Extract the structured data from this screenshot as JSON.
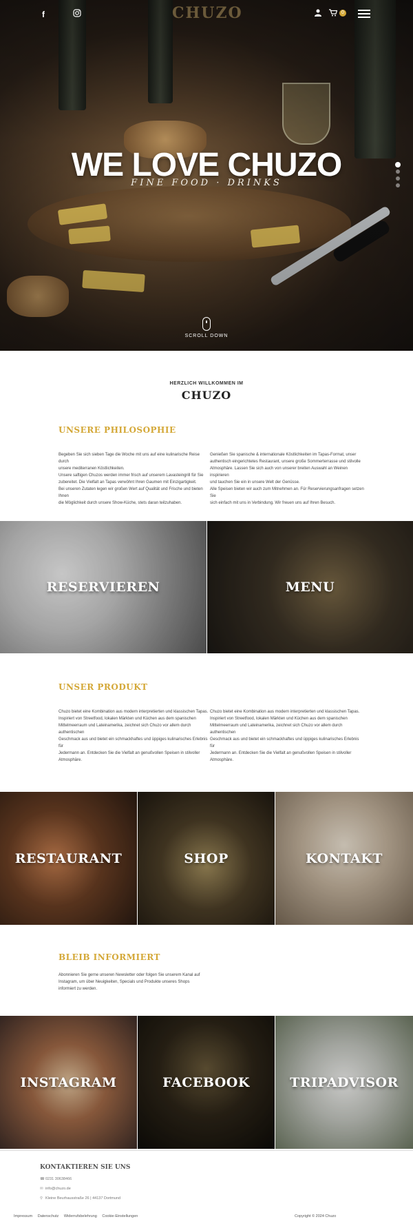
{
  "header": {
    "logo": "CHUZO",
    "social": [
      "facebook-icon",
      "instagram-icon"
    ],
    "cart_count": "0",
    "icons": [
      "user-icon",
      "cart-icon",
      "menu-icon"
    ]
  },
  "hero": {
    "title": "WE LOVE CHUZO",
    "subtitle": "FINE FOOD · DRINKS",
    "scroll_label": "SCROLL DOWN",
    "slides": 4,
    "active_slide": 1
  },
  "welcome": {
    "kicker": "HERZLICH WILLKOMMEN IM",
    "title": "CHUZO"
  },
  "philosophie": {
    "heading": "UNSERE PHILOSOPHIE",
    "col1": [
      "Begeben Sie sich sieben Tage die Woche mit uns auf eine kulinarische Reise durch",
      "unsere mediterranen Köstlichkeiten.",
      "Unsere saftigen Chuzos werden immer frisch auf unserem Lavasteingrill für Sie",
      "zubereitet. Die Vielfalt an Tapas verwöhnt Ihren Gaumen mit Einzigartigkeit.",
      "Bei unseren Zutaten legen wir großen Wert auf Qualität und Frische und bieten Ihnen",
      "die Möglichkeit durch unsere Show-Küche, stets daran teilzuhaben."
    ],
    "col2": [
      "Genießen Sie spanische & internationale Köstlichkeiten im Tapas-Format, unser",
      "authentisch eingerichtetes Restaurant, unsere große Sommerterrasse und stilvolle",
      "Atmosphäre. Lassen Sie sich auch von unserer breiten Auswahl an Weinen inspirieren",
      "und tauchen Sie ein in unsere Welt der Genüsse.",
      "Alle Speisen bieten wir auch zum Mitnehmen an. Für Reservierungsanfragen setzen Sie",
      "sich einfach mit uns in Verbindung. Wir freuen uns auf Ihren Besuch."
    ]
  },
  "tiles_row1": [
    {
      "label": "RESERVIEREN"
    },
    {
      "label": "MENU"
    }
  ],
  "produkt": {
    "heading": "UNSER PRODUKT",
    "col1": [
      "Chuzo bietet eine Kombination aus modern interpretierten und klassischen Tapas.",
      "Inspiriert von Streetfood, lokalen Märkten und Küchen aus dem spanischen",
      "Mittelmeerraum und Lateinamerika, zeichnet sich Chuzo vor allem durch authentischen",
      "Geschmack aus und bietet ein schmackhaftes und üppiges kulinarisches Erlebnis für",
      "Jedermann an. Entdecken Sie die Vielfalt an genußvollen Speisen in stilvoller",
      "Atmosphäre."
    ],
    "col2": [
      "Chuzo bietet eine Kombination aus modern interpretierten und klassischen Tapas.",
      "Inspiriert von Streetfood, lokalen Märkten und Küchen aus dem spanischen",
      "Mittelmeerraum und Lateinamerika, zeichnet sich Chuzo vor allem durch authentischen",
      "Geschmack aus und bietet ein schmackhaftes und üppiges kulinarisches Erlebnis für",
      "Jedermann an. Entdecken Sie die Vielfalt an genußvollen Speisen in stilvoller",
      "Atmosphäre."
    ]
  },
  "tiles_row2": [
    {
      "label": "RESTAURANT"
    },
    {
      "label": "SHOP"
    },
    {
      "label": "KONTAKT"
    }
  ],
  "newsletter": {
    "heading": "BLEIB INFORMIERT",
    "lines": [
      "Abonnieren Sie gerne unseren Newsletter oder folgen Sie unserem Kanal auf",
      "Instagram, um über Neuigkeiten, Specials und Produkte unseres Shops",
      "informiert zu werden."
    ]
  },
  "tiles_row3": [
    {
      "label": "INSTAGRAM"
    },
    {
      "label": "FACEBOOK"
    },
    {
      "label": "TRIPADVISOR"
    }
  ],
  "contact": {
    "heading": "KONTAKTIEREN SIE UNS",
    "phone": "0231 30638466",
    "email": "info@chuzo.de",
    "address": "Kleine Beurhausstraße 26 | 44137 Dortmund"
  },
  "footer": {
    "links": [
      "Impressum",
      "Datenschutz",
      "Widerrufsbelehrung",
      "Cookie-Einstellungen"
    ],
    "copyright": "Copyright © 2024 Chuzo"
  },
  "colors": {
    "accent": "#d4a838",
    "text": "#333333",
    "background": "#ffffff"
  }
}
